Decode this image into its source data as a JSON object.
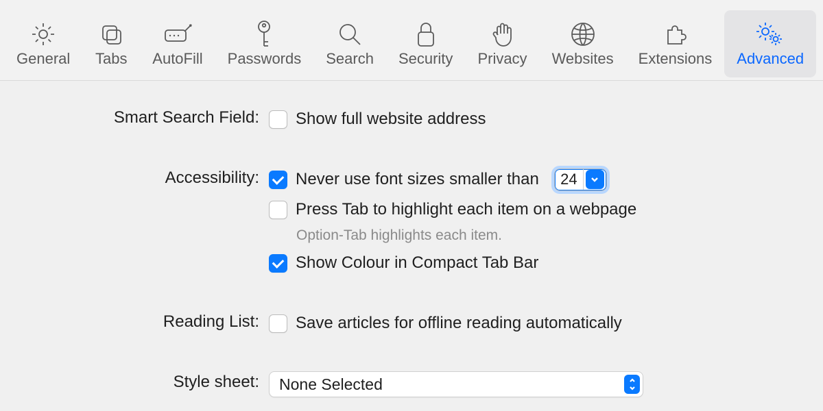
{
  "toolbar": {
    "tabs": [
      {
        "id": "general",
        "label": "General"
      },
      {
        "id": "tabs",
        "label": "Tabs"
      },
      {
        "id": "autofill",
        "label": "AutoFill"
      },
      {
        "id": "passwords",
        "label": "Passwords"
      },
      {
        "id": "search",
        "label": "Search"
      },
      {
        "id": "security",
        "label": "Security"
      },
      {
        "id": "privacy",
        "label": "Privacy"
      },
      {
        "id": "websites",
        "label": "Websites"
      },
      {
        "id": "extensions",
        "label": "Extensions"
      },
      {
        "id": "advanced",
        "label": "Advanced",
        "active": true
      }
    ]
  },
  "sections": {
    "smart_search": {
      "title": "Smart Search Field:",
      "show_full_address": {
        "label": "Show full website address",
        "checked": false
      }
    },
    "accessibility": {
      "title": "Accessibility:",
      "min_font": {
        "label": "Never use font sizes smaller than",
        "checked": true,
        "value": "24"
      },
      "press_tab": {
        "label": "Press Tab to highlight each item on a webpage",
        "checked": false
      },
      "press_tab_hint": "Option-Tab highlights each item.",
      "show_colour": {
        "label": "Show Colour in Compact Tab Bar",
        "checked": true
      }
    },
    "reading_list": {
      "title": "Reading List:",
      "offline": {
        "label": "Save articles for offline reading automatically",
        "checked": false
      }
    },
    "style_sheet": {
      "title": "Style sheet:",
      "value": "None Selected"
    }
  }
}
